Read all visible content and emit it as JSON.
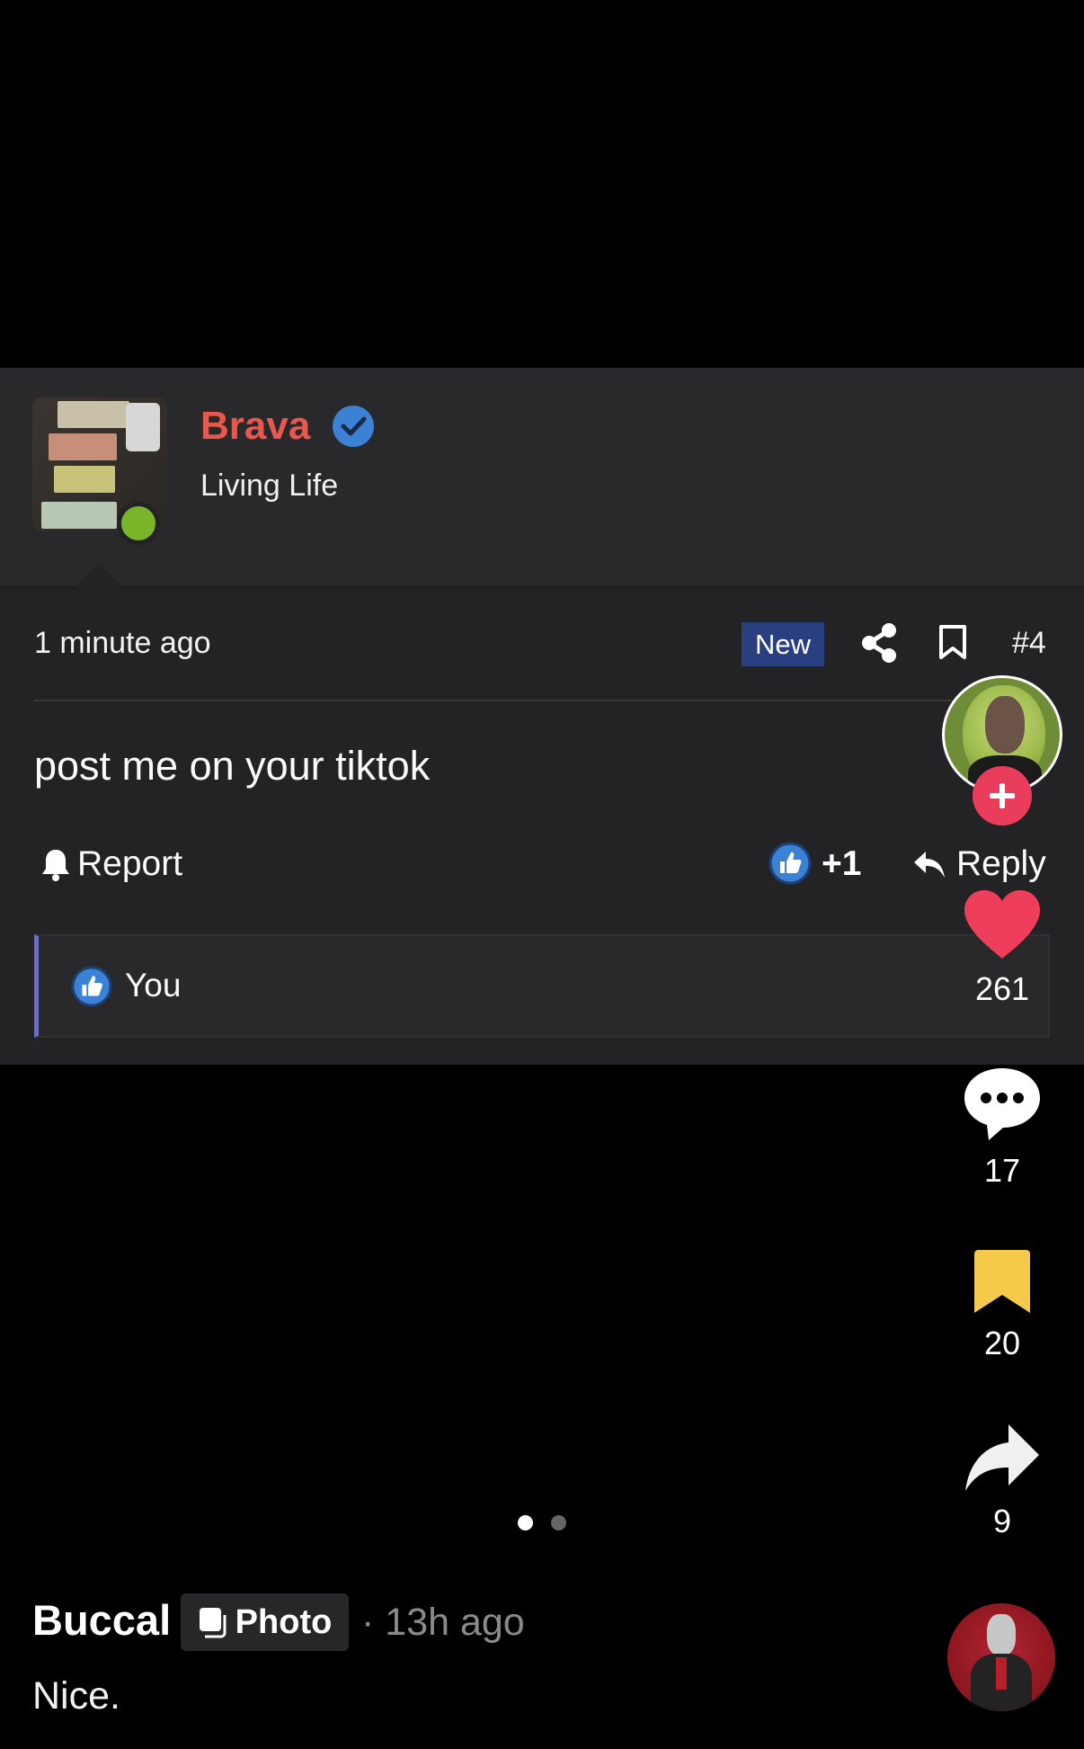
{
  "post": {
    "author_name": "Brava",
    "author_title": "Living Life",
    "timestamp": "1 minute ago",
    "badge": "New",
    "post_number": "#4",
    "text": "post me on your tiktok",
    "report_label": "Report",
    "like_count": "+1",
    "reply_label": "Reply",
    "reactions": [
      {
        "user": "You"
      }
    ],
    "colors": {
      "author_name": "#e8584d",
      "online": "#7ab529",
      "badge_bg": "#2a3f7f",
      "reaction_bar": "#6a6fc0"
    }
  },
  "side_actions": {
    "likes": "261",
    "comments": "17",
    "saves": "20",
    "shares": "9",
    "icons": [
      "plus-icon",
      "heart-icon",
      "comment-bubble-icon",
      "bookmark-icon",
      "share-arrow-icon"
    ],
    "colors": {
      "heart": "#ef3e5c",
      "bookmark": "#f5c94a",
      "follow": "#ea3d5c"
    }
  },
  "pagination": {
    "current": 1,
    "total": 2
  },
  "video": {
    "author": "Buccal",
    "type_label": "Photo",
    "time": "· 13h ago",
    "caption": "Nice."
  }
}
